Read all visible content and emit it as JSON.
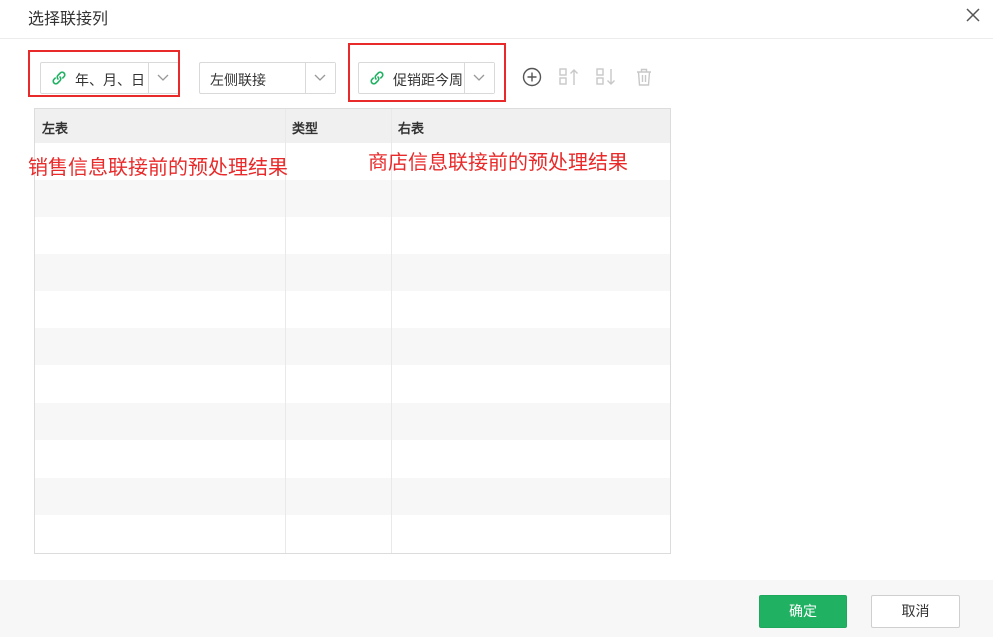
{
  "dialog": {
    "title": "选择联接列"
  },
  "toolbar": {
    "left_column_value": "年、月、日",
    "join_type_value": "左侧联接",
    "right_column_value": "促销距今周"
  },
  "grid": {
    "columns": [
      "左表",
      "类型",
      "右表"
    ],
    "rows": []
  },
  "annotations": {
    "left": "销售信息联接前的预处理结果",
    "right": "商店信息联接前的预处理结果"
  },
  "footer": {
    "ok_label": "确定",
    "cancel_label": "取消"
  },
  "colors": {
    "accent": "#21b163",
    "annotation": "#e82a2a"
  },
  "icons": [
    "close-icon",
    "link-icon",
    "chevron-down-icon",
    "add-circle-icon",
    "move-up-icon",
    "move-down-icon",
    "delete-icon"
  ]
}
